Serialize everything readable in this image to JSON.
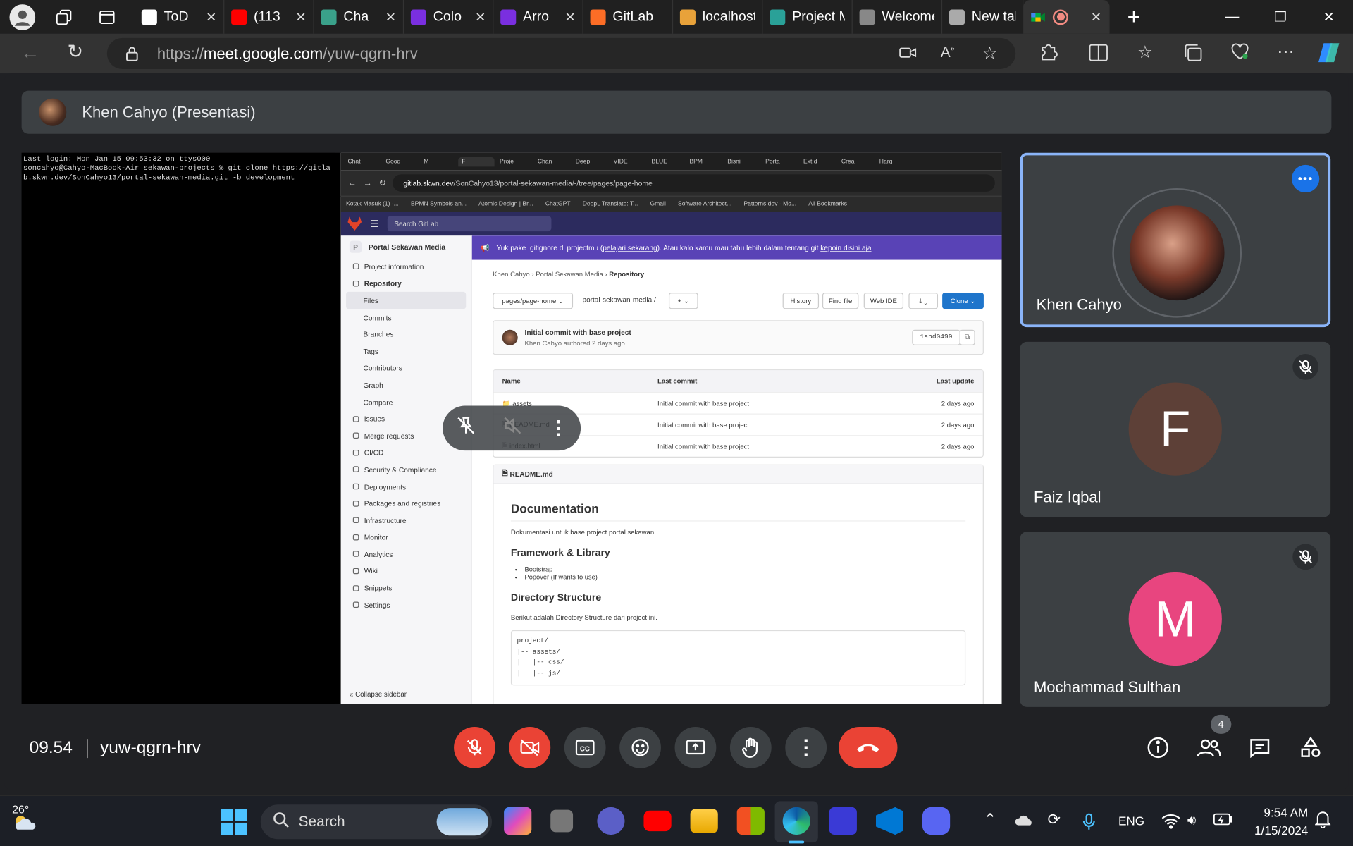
{
  "browser": {
    "tabs": [
      {
        "label": "ToD",
        "color": "#ffffff"
      },
      {
        "label": "(113",
        "color": "#ff0000"
      },
      {
        "label": "Cha",
        "color": "#3aa18a"
      },
      {
        "label": "Colo",
        "color": "#7a2fe0"
      },
      {
        "label": "Arro",
        "color": "#7a2fe0"
      },
      {
        "label": "GitLab",
        "color": "#fc6d26"
      },
      {
        "label": "localhost",
        "color": "#e8a23a"
      },
      {
        "label": "Project M",
        "color": "#2aa198"
      },
      {
        "label": "Welcome",
        "color": "#888888"
      },
      {
        "label": "New tab",
        "color": "#aaaaaa"
      }
    ],
    "url_prefix": "https://",
    "url_domain": "meet.google.com",
    "url_path": "/yuw-qgrn-hrv"
  },
  "presenter": {
    "label": "Khen Cahyo (Presentasi)"
  },
  "terminal": {
    "text": "Last login: Mon Jan 15 09:53:32 on ttys000\nsoncahyo@Cahyo-MacBook-Air sekawan-projects % git clone https://gitlab.skwn.dev/SonCahyo13/portal-sekawan-media.git -b development"
  },
  "shared": {
    "tabs": [
      "Chat",
      "Goog",
      "M",
      "F",
      "Proje",
      "Chan",
      "Deep",
      "VIDE",
      "BLUE",
      "BPM",
      "Bisni",
      "Porta",
      "Ext.d",
      "Crea",
      "Harg"
    ],
    "url_domain": "gitlab.skwn.dev",
    "url_path": "/SonCahyo13/portal-sekawan-media/-/tree/pages/page-home",
    "bookmarks": [
      "Kotak Masuk (1) -...",
      "BPMN Symbols an...",
      "Atomic Design | Br...",
      "ChatGPT",
      "DeepL Translate: T...",
      "Gmail",
      "Software Architect...",
      "Patterns.dev - Mo...",
      "All Bookmarks"
    ],
    "search": "Search GitLab",
    "project_initial": "P",
    "project": "Portal Sekawan Media",
    "sidebar": [
      "Project information",
      "Repository",
      "Files",
      "Commits",
      "Branches",
      "Tags",
      "Contributors",
      "Graph",
      "Compare",
      "Issues",
      "Merge requests",
      "CI/CD",
      "Security & Compliance",
      "Deployments",
      "Packages and registries",
      "Infrastructure",
      "Monitor",
      "Analytics",
      "Wiki",
      "Snippets",
      "Settings"
    ],
    "collapse": "Collapse sidebar",
    "banner_a": "Yuk pake .gitignore di projectmu (",
    "banner_link1": "pelajari sekarang",
    "banner_b": "). Atau kalo kamu mau tahu lebih dalam tentang git ",
    "banner_link2": "kepoin disini aja",
    "crumbs": [
      "Khen Cahyo",
      "Portal Sekawan Media",
      "Repository"
    ],
    "branch": "pages/page-home",
    "repo_path": "portal-sekawan-media /",
    "btn_history": "History",
    "btn_find": "Find file",
    "btn_ide": "Web IDE",
    "btn_clone": "Clone",
    "commit_msg": "Initial commit with base project",
    "commit_author": "Khen Cahyo",
    "commit_meta": "authored 2 days ago",
    "commit_sha": "1abd0499",
    "headers": [
      "Name",
      "Last commit",
      "Last update"
    ],
    "files": [
      {
        "name": "assets",
        "commit": "Initial commit with base project",
        "updated": "2 days ago"
      },
      {
        "name": "README.md",
        "commit": "Initial commit with base project",
        "updated": "2 days ago"
      },
      {
        "name": "index.html",
        "commit": "Initial commit with base project",
        "updated": "2 days ago"
      }
    ],
    "readme_file": "README.md",
    "h_doc": "Documentation",
    "p_doc": "Dokumentasi untuk base project portal sekawan",
    "h_fw": "Framework & Library",
    "li1": "Bootstrap",
    "li2": "Popover (If wants to use)",
    "h_dir": "Directory Structure",
    "p_dir": "Berikut adalah Directory Structure dari project ini.",
    "code": "project/\n|-- assets/\n|   |-- css/\n|   |-- js/"
  },
  "participants": [
    {
      "name": "Khen Cahyo",
      "initial": "",
      "color": "#3c4043"
    },
    {
      "name": "Faiz Iqbal",
      "initial": "F",
      "color": "#5d4037"
    },
    {
      "name": "Mochammad Sulthan",
      "initial": "M",
      "color": "#e8457f"
    }
  ],
  "meeting": {
    "time": "09.54",
    "code": "yuw-qgrn-hrv",
    "people_count": "4"
  },
  "taskbar": {
    "temp": "26°",
    "search": "Search",
    "lang": "ENG",
    "time": "9:54 AM",
    "date": "1/15/2024"
  }
}
